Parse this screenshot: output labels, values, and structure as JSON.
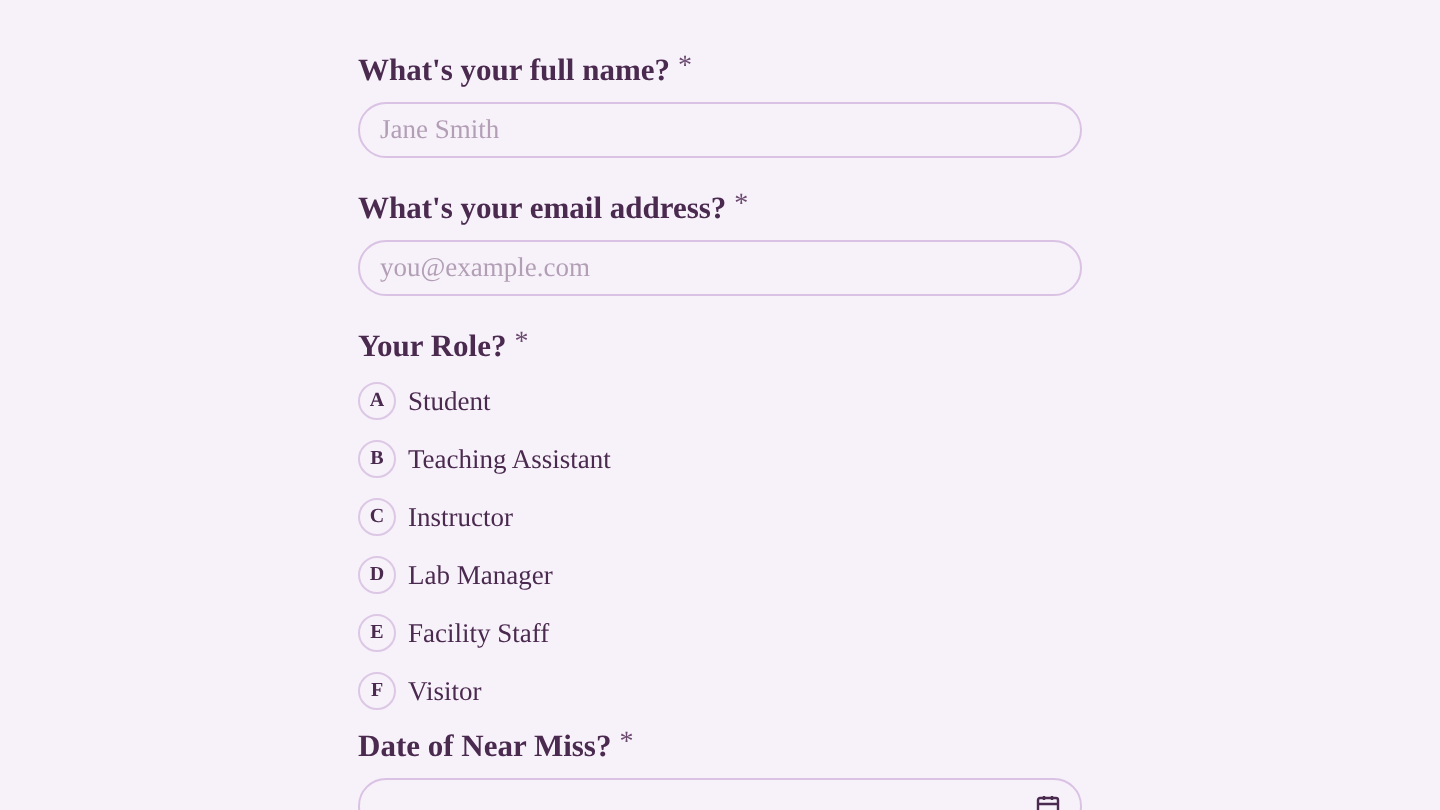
{
  "questions": [
    {
      "kind": "text",
      "label": "What's your full name?",
      "required_mark": "*",
      "placeholder": "Jane Smith"
    },
    {
      "kind": "text",
      "label": "What's your email address?",
      "required_mark": "*",
      "placeholder": "you@example.com"
    },
    {
      "kind": "choice",
      "label": "Your Role?",
      "required_mark": "*",
      "options": [
        {
          "key": "A",
          "label": "Student",
          "selected": false
        },
        {
          "key": "B",
          "label": "Teaching Assistant",
          "selected": false
        },
        {
          "key": "C",
          "label": "Instructor",
          "selected": false
        },
        {
          "key": "D",
          "label": "Lab Manager",
          "selected": false
        },
        {
          "key": "E",
          "label": "Facility Staff",
          "selected": false
        },
        {
          "key": "F",
          "label": "Visitor",
          "selected": false
        }
      ]
    },
    {
      "kind": "date",
      "label": "Date of Near Miss?",
      "required_mark": "*"
    }
  ]
}
